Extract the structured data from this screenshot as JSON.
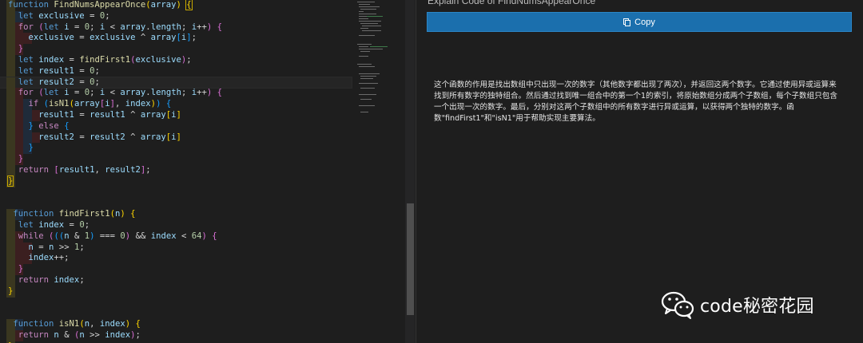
{
  "editor": {
    "code_lines": [
      [
        [
          "k",
          "function "
        ],
        [
          "f",
          "FindNumsAppearOnce"
        ],
        [
          "p1",
          "("
        ],
        [
          "v",
          "array"
        ],
        [
          "p1",
          ")"
        ],
        [
          "o",
          " "
        ],
        [
          "p1b",
          "{"
        ]
      ],
      [
        [
          "o",
          "  "
        ],
        [
          "k",
          "let "
        ],
        [
          "v",
          "exclusive"
        ],
        [
          "o",
          " = "
        ],
        [
          "n",
          "0"
        ],
        [
          "o",
          ";"
        ]
      ],
      [
        [
          "o",
          "  "
        ],
        [
          "c",
          "for "
        ],
        [
          "p2",
          "("
        ],
        [
          "k",
          "let "
        ],
        [
          "v",
          "i"
        ],
        [
          "o",
          " = "
        ],
        [
          "n",
          "0"
        ],
        [
          "o",
          "; "
        ],
        [
          "v",
          "i"
        ],
        [
          "o",
          " < "
        ],
        [
          "v",
          "array"
        ],
        [
          "o",
          "."
        ],
        [
          "v",
          "length"
        ],
        [
          "o",
          "; "
        ],
        [
          "v",
          "i"
        ],
        [
          "o",
          "++"
        ],
        [
          "p2",
          ")"
        ],
        [
          "o",
          " "
        ],
        [
          "p2",
          "{"
        ]
      ],
      [
        [
          "o",
          "    "
        ],
        [
          "v",
          "exclusive"
        ],
        [
          "o",
          " = "
        ],
        [
          "v",
          "exclusive"
        ],
        [
          "o",
          " ^ "
        ],
        [
          "v",
          "array"
        ],
        [
          "p3",
          "["
        ],
        [
          "v",
          "i"
        ],
        [
          "p3",
          "]"
        ],
        [
          "o",
          ";"
        ]
      ],
      [
        [
          "o",
          "  "
        ],
        [
          "p2",
          "}"
        ]
      ],
      [
        [
          "o",
          "  "
        ],
        [
          "k",
          "let "
        ],
        [
          "v",
          "index"
        ],
        [
          "o",
          " = "
        ],
        [
          "f",
          "findFirst1"
        ],
        [
          "p2",
          "("
        ],
        [
          "v",
          "exclusive"
        ],
        [
          "p2",
          ")"
        ],
        [
          "o",
          ";"
        ]
      ],
      [
        [
          "o",
          "  "
        ],
        [
          "k",
          "let "
        ],
        [
          "v",
          "result1"
        ],
        [
          "o",
          " = "
        ],
        [
          "n",
          "0"
        ],
        [
          "o",
          ";"
        ]
      ],
      [
        [
          "o",
          "  "
        ],
        [
          "k",
          "let "
        ],
        [
          "v",
          "result2"
        ],
        [
          "o",
          " = "
        ],
        [
          "n",
          "0"
        ],
        [
          "o",
          ";"
        ]
      ],
      [
        [
          "o",
          "  "
        ],
        [
          "c",
          "for "
        ],
        [
          "p2",
          "("
        ],
        [
          "k",
          "let "
        ],
        [
          "v",
          "i"
        ],
        [
          "o",
          " = "
        ],
        [
          "n",
          "0"
        ],
        [
          "o",
          "; "
        ],
        [
          "v",
          "i"
        ],
        [
          "o",
          " < "
        ],
        [
          "v",
          "array"
        ],
        [
          "o",
          "."
        ],
        [
          "v",
          "length"
        ],
        [
          "o",
          "; "
        ],
        [
          "v",
          "i"
        ],
        [
          "o",
          "++"
        ],
        [
          "p2",
          ")"
        ],
        [
          "o",
          " "
        ],
        [
          "p2",
          "{"
        ]
      ],
      [
        [
          "o",
          "    "
        ],
        [
          "c",
          "if "
        ],
        [
          "p3",
          "("
        ],
        [
          "f",
          "isN1"
        ],
        [
          "p1",
          "("
        ],
        [
          "v",
          "array"
        ],
        [
          "p2",
          "["
        ],
        [
          "v",
          "i"
        ],
        [
          "p2",
          "]"
        ],
        [
          "o",
          ", "
        ],
        [
          "v",
          "index"
        ],
        [
          "p1",
          ")"
        ],
        [
          "p3",
          ")"
        ],
        [
          "o",
          " "
        ],
        [
          "p3",
          "{"
        ]
      ],
      [
        [
          "o",
          "      "
        ],
        [
          "v",
          "result1"
        ],
        [
          "o",
          " = "
        ],
        [
          "v",
          "result1"
        ],
        [
          "o",
          " ^ "
        ],
        [
          "v",
          "array"
        ],
        [
          "p1",
          "["
        ],
        [
          "v",
          "i"
        ],
        [
          "p1",
          "]"
        ]
      ],
      [
        [
          "o",
          "    "
        ],
        [
          "p3",
          "}"
        ],
        [
          "o",
          " "
        ],
        [
          "c",
          "else "
        ],
        [
          "p3",
          "{"
        ]
      ],
      [
        [
          "o",
          "      "
        ],
        [
          "v",
          "result2"
        ],
        [
          "o",
          " = "
        ],
        [
          "v",
          "result2"
        ],
        [
          "o",
          " ^ "
        ],
        [
          "v",
          "array"
        ],
        [
          "p1",
          "["
        ],
        [
          "v",
          "i"
        ],
        [
          "p1",
          "]"
        ]
      ],
      [
        [
          "o",
          "    "
        ],
        [
          "p3",
          "}"
        ]
      ],
      [
        [
          "o",
          "  "
        ],
        [
          "p2",
          "}"
        ]
      ],
      [
        [
          "o",
          "  "
        ],
        [
          "c",
          "return "
        ],
        [
          "p2",
          "["
        ],
        [
          "v",
          "result1"
        ],
        [
          "o",
          ", "
        ],
        [
          "v",
          "result2"
        ],
        [
          "p2",
          "]"
        ],
        [
          "o",
          ";"
        ]
      ],
      [
        [
          "p1b",
          "}"
        ]
      ],
      [],
      [],
      [
        [
          "o",
          " "
        ],
        [
          "k",
          "function "
        ],
        [
          "f",
          "findFirst1"
        ],
        [
          "p1",
          "("
        ],
        [
          "v",
          "n"
        ],
        [
          "p1",
          ")"
        ],
        [
          "o",
          " "
        ],
        [
          "p1",
          "{"
        ]
      ],
      [
        [
          "o",
          "  "
        ],
        [
          "k",
          "let "
        ],
        [
          "v",
          "index"
        ],
        [
          "o",
          " = "
        ],
        [
          "n",
          "0"
        ],
        [
          "o",
          ";"
        ]
      ],
      [
        [
          "o",
          "  "
        ],
        [
          "c",
          "while "
        ],
        [
          "p2",
          "("
        ],
        [
          "p3",
          "(("
        ],
        [
          "v",
          "n"
        ],
        [
          "o",
          " & "
        ],
        [
          "n",
          "1"
        ],
        [
          "p3",
          ")"
        ],
        [
          "o",
          " === "
        ],
        [
          "n",
          "0"
        ],
        [
          "p2",
          ")"
        ],
        [
          "o",
          " && "
        ],
        [
          "v",
          "index"
        ],
        [
          "o",
          " < "
        ],
        [
          "n",
          "64"
        ],
        [
          "p2",
          ")"
        ],
        [
          "o",
          " "
        ],
        [
          "p2",
          "{"
        ]
      ],
      [
        [
          "o",
          "    "
        ],
        [
          "v",
          "n"
        ],
        [
          "o",
          " = "
        ],
        [
          "v",
          "n"
        ],
        [
          "o",
          " >> "
        ],
        [
          "n",
          "1"
        ],
        [
          "o",
          ";"
        ]
      ],
      [
        [
          "o",
          "    "
        ],
        [
          "v",
          "index"
        ],
        [
          "o",
          "++;"
        ]
      ],
      [
        [
          "o",
          "  "
        ],
        [
          "p2",
          "}"
        ]
      ],
      [
        [
          "o",
          "  "
        ],
        [
          "c",
          "return "
        ],
        [
          "v",
          "index"
        ],
        [
          "o",
          ";"
        ]
      ],
      [
        [
          "p1",
          "}"
        ]
      ],
      [],
      [],
      [
        [
          "o",
          " "
        ],
        [
          "k",
          "function "
        ],
        [
          "f",
          "isN1"
        ],
        [
          "p1",
          "("
        ],
        [
          "v",
          "n"
        ],
        [
          "o",
          ", "
        ],
        [
          "v",
          "index"
        ],
        [
          "p1",
          ")"
        ],
        [
          "o",
          " "
        ],
        [
          "p1",
          "{"
        ]
      ],
      [
        [
          "o",
          "  "
        ],
        [
          "c",
          "return "
        ],
        [
          "v",
          "n"
        ],
        [
          "o",
          " & "
        ],
        [
          "p2",
          "("
        ],
        [
          "v",
          "n"
        ],
        [
          "o",
          " >> "
        ],
        [
          "v",
          "index"
        ],
        [
          "p2",
          ")"
        ],
        [
          "o",
          ";"
        ]
      ],
      [
        [
          "p1",
          "}"
        ]
      ]
    ],
    "gutter": [
      "y",
      "yb",
      "yr",
      "yrr",
      "yr",
      "y",
      "y",
      "y",
      "yr",
      "yrb",
      "yrbr",
      "yrb",
      "yrbr",
      "yrb",
      "yr",
      "y",
      "y",
      "",
      "",
      "yb",
      "y",
      "yr",
      "yrr",
      "yrr",
      "yr",
      "y",
      "y",
      "",
      "",
      "yb",
      "yr",
      "y"
    ],
    "current_line": 7
  },
  "panel": {
    "heading": "Explain Code of FindNumsAppearOnce",
    "copy_label": "Copy",
    "explanation": "这个函数的作用是找出数组中只出现一次的数字（其他数字都出现了两次），并返回这两个数字。它通过使用异或运算来找到所有数字的独特组合。然后通过找到唯一组合中的第一个1的索引，将原始数组分成两个子数组，每个子数组只包含一个出现一次的数字。最后，分别对这两个子数组中的所有数字进行异或运算，以获得两个独特的数字。函数\"findFirst1\"和\"isN1\"用于帮助实现主要算法。"
  },
  "watermark": {
    "text": "code秘密花园",
    "icon": "wechat-icon"
  },
  "colors": {
    "accent": "#1b6fad",
    "background": "#1e1e1e"
  }
}
